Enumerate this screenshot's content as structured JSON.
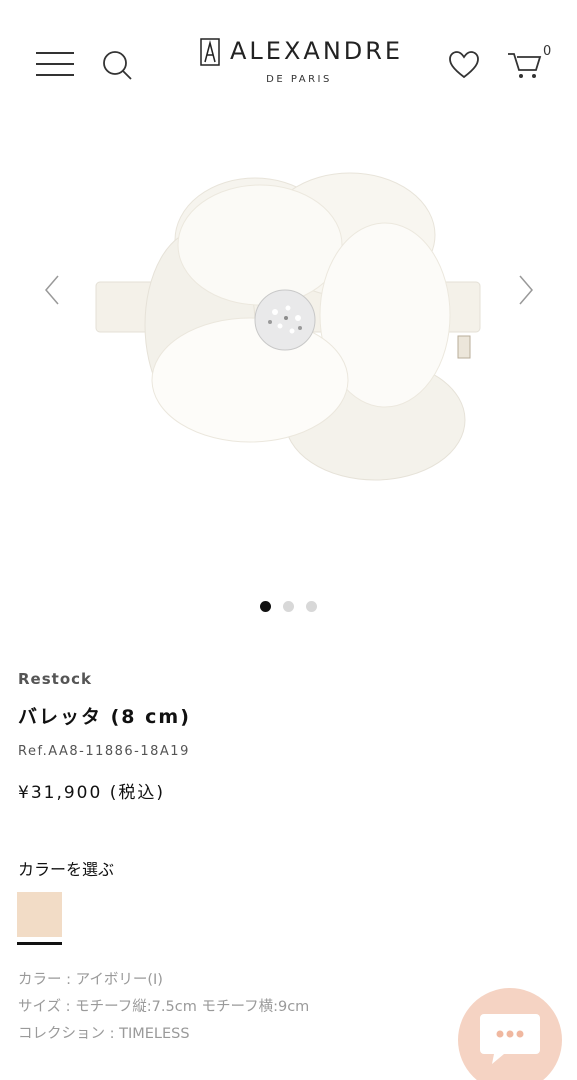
{
  "header": {
    "logo_main": "ALEXANDRE",
    "logo_sub": "DE PARIS",
    "cart_count": "0",
    "icons": [
      "hamburger-menu-icon",
      "search-icon",
      "heart-icon",
      "cart-icon"
    ]
  },
  "carousel": {
    "image_count": 3,
    "active_index": 0
  },
  "product": {
    "badge": "Restock",
    "title": "バレッタ (8 cm)",
    "ref": "Ref.AA8-11886-18A19",
    "price": "¥31,900 (税込)"
  },
  "color": {
    "heading": "カラーを選ぶ",
    "swatch_color": "#f2dcc6"
  },
  "specs": [
    "カラー : アイボリー(I)",
    "サイズ : モチーフ縦:7.5cm モチーフ横:9cm",
    "コレクション : TIMELESS"
  ],
  "chat": {
    "icon": "chat-bubble-icon",
    "color": "#f5d3c3"
  }
}
